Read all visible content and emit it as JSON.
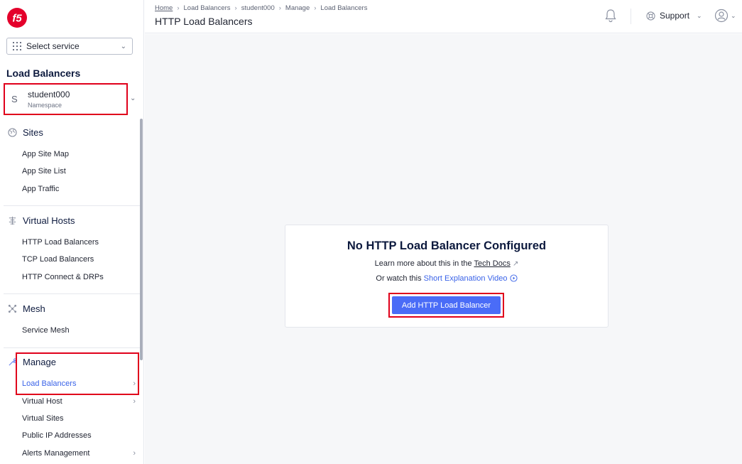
{
  "sidebar": {
    "select_service": "Select service",
    "section_title": "Load Balancers",
    "namespace": {
      "avatar": "S",
      "name": "student000",
      "label": "Namespace"
    },
    "groups": [
      {
        "title": "Sites",
        "icon": "globe-icon",
        "items": [
          "App Site Map",
          "App Site List",
          "App Traffic"
        ]
      },
      {
        "title": "Virtual Hosts",
        "icon": "virtual-hosts-icon",
        "items": [
          "HTTP Load Balancers",
          "TCP Load Balancers",
          "HTTP Connect & DRPs"
        ]
      },
      {
        "title": "Mesh",
        "icon": "mesh-icon",
        "items": [
          "Service Mesh"
        ]
      },
      {
        "title": "Manage",
        "icon": "wrench-icon",
        "items": [
          "Load Balancers",
          "Virtual Host",
          "Virtual Sites",
          "Public IP Addresses",
          "Alerts Management"
        ]
      }
    ]
  },
  "header": {
    "breadcrumb": [
      "Home",
      "Load Balancers",
      "student000",
      "Manage",
      "Load Balancers"
    ],
    "title": "HTTP Load Balancers",
    "support_label": "Support"
  },
  "empty_state": {
    "title": "No HTTP Load Balancer Configured",
    "learn_prefix": "Learn more about this in the",
    "learn_link": "Tech Docs",
    "watch_prefix": "Or watch this",
    "watch_link": "Short Explanation Video",
    "button": "Add HTTP Load Balancer"
  },
  "colors": {
    "accent": "#4a6cf7",
    "highlight": "#e0001b",
    "brand": "#e4002b"
  }
}
